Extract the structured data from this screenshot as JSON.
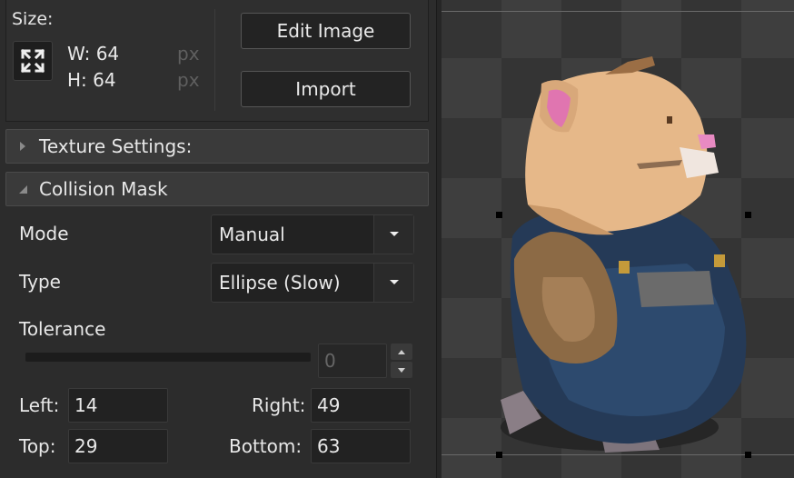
{
  "size": {
    "label": "Size:",
    "width": "W: 64",
    "height": "H: 64",
    "unit": "px",
    "resize_icon": "expand-arrows-icon"
  },
  "buttons": {
    "edit_image": "Edit Image",
    "import": "Import"
  },
  "sections": {
    "texture_settings": "Texture Settings:",
    "collision_mask": "Collision Mask"
  },
  "collision": {
    "mode_label": "Mode",
    "mode_value": "Manual",
    "type_label": "Type",
    "type_value": "Ellipse (Slow)",
    "tolerance_label": "Tolerance",
    "tolerance_value": "0",
    "left_label": "Left:",
    "left_value": "14",
    "right_label": "Right:",
    "right_value": "49",
    "top_label": "Top:",
    "top_value": "29",
    "bottom_label": "Bottom:",
    "bottom_value": "63"
  },
  "colors": {
    "panel": "#2c2c2c",
    "section": "#3a3a3a",
    "field": "#222222",
    "checker_light": "#3e3e3e",
    "checker_dark": "#343434"
  }
}
